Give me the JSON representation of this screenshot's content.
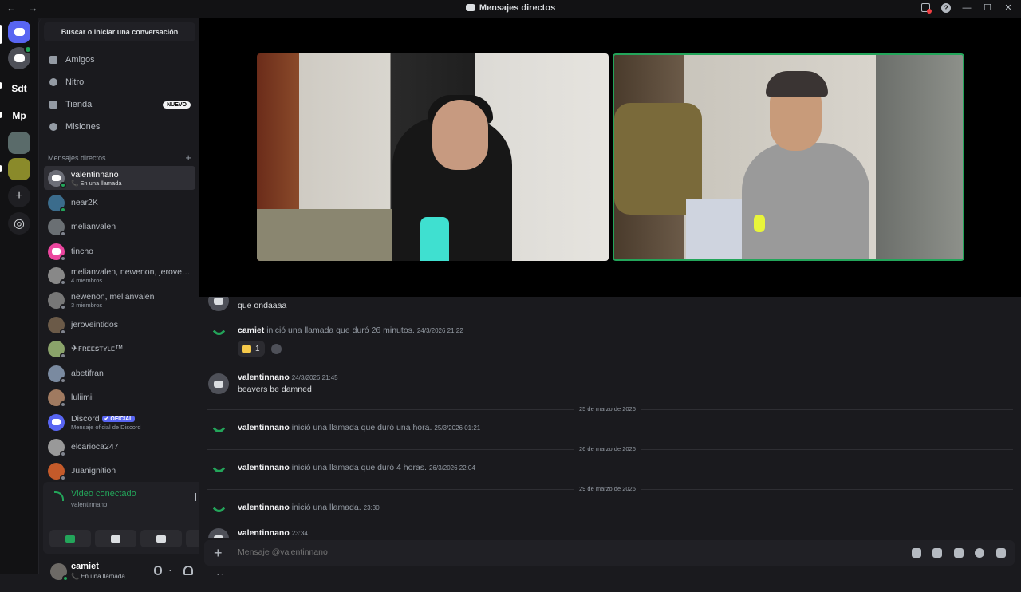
{
  "titlebar": {
    "nav": "← →",
    "title": "Mensajes directos"
  },
  "servers": [
    "Sdt",
    "Mp"
  ],
  "sidebar": {
    "search": "Buscar o iniciar una conversación",
    "nav": [
      {
        "label": "Amigos"
      },
      {
        "label": "Nitro"
      },
      {
        "label": "Tienda",
        "badge": "NUEVO"
      },
      {
        "label": "Misiones"
      }
    ],
    "dm_header": "Mensajes directos",
    "dms": [
      {
        "name": "valentinnano",
        "sub": "📞 En una llamada",
        "color": "#6d6f78"
      },
      {
        "name": "near2K",
        "sub": "",
        "color": "#3b6c8c"
      },
      {
        "name": "melianvalen",
        "sub": "",
        "color": "#6a6f73"
      },
      {
        "name": "tincho",
        "sub": "",
        "color": "#eb459e"
      },
      {
        "name": "melianvalen, newenon, jeroveintidos",
        "sub": "4 miembros",
        "color": "#888"
      },
      {
        "name": "newenon, melianvalen",
        "sub": "3 miembros",
        "color": "#777"
      },
      {
        "name": "jeroveintidos",
        "sub": "",
        "color": "#6b5a48"
      },
      {
        "name": "✈ꜰʀᴇᴇꜱᴛʏʟᴇ™",
        "sub": "",
        "color": "#8aa36a"
      },
      {
        "name": "abetifran",
        "sub": "",
        "color": "#7a8aa0"
      },
      {
        "name": "luliimii",
        "sub": "",
        "color": "#a07a60"
      },
      {
        "name": "Discord",
        "badge": "✔ OFICIAL",
        "sub": "Mensaje oficial de Discord",
        "color": "#5865f2"
      },
      {
        "name": "elcarioca247",
        "sub": "",
        "color": "#999"
      },
      {
        "name": "Juanignition",
        "sub": "",
        "color": "#c45a2a"
      }
    ]
  },
  "voice": {
    "title": "Video conectado",
    "sub": "valentinnano"
  },
  "user": {
    "name": "camiet",
    "status": "📞 En una llamada"
  },
  "chat": {
    "m0": {
      "text": "que ondaaaa"
    },
    "m1": {
      "author": "camiet",
      "text": "inició una llamada que duró 26 minutos.",
      "time": "24/3/2026 21:22",
      "reaction_count": "1"
    },
    "m2": {
      "author": "valentinnano",
      "time": "24/3/2026 21:45",
      "text": "beavers be damned"
    },
    "d1": "25 de marzo de 2026",
    "m3": {
      "author": "valentinnano",
      "text": "inició una llamada que duró una hora.",
      "time": "25/3/2026 01:21"
    },
    "d2": "26 de marzo de 2026",
    "m4": {
      "author": "valentinnano",
      "text": "inició una llamada que duró 4 horas.",
      "time": "26/3/2026 22:04"
    },
    "d3": "29 de marzo de 2026",
    "m5": {
      "author": "valentinnano",
      "text": "inició una llamada.",
      "time": "23:30"
    },
    "m6": {
      "author": "valentinnano",
      "time": "23:34"
    }
  },
  "composer": {
    "placeholder": "Mensaje @valentinnano"
  },
  "colors": {
    "accent": "#5865f2",
    "online": "#23a55a"
  }
}
